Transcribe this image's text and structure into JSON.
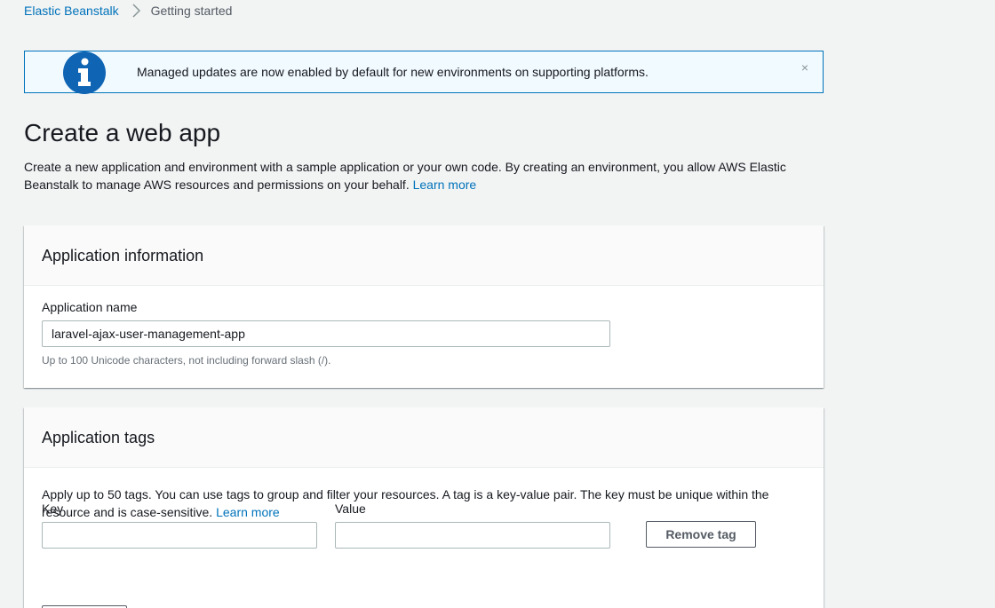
{
  "breadcrumb": {
    "root": "Elastic Beanstalk",
    "current": "Getting started"
  },
  "flash": {
    "message": "Managed updates are now enabled by default for new environments on supporting platforms.",
    "close_glyph": "×",
    "icon": "info-icon"
  },
  "header": {
    "title": "Create a web app",
    "description": "Create a new application and environment with a sample application or your own code. By creating an environment, you allow AWS Elastic Beanstalk to manage AWS resources and permissions on your behalf.",
    "learn_more": "Learn more"
  },
  "app_info": {
    "title": "Application information",
    "name_label": "Application name",
    "name_value": "laravel-ajax-user-management-app",
    "name_hint": "Up to 100 Unicode characters, not including forward slash (/)."
  },
  "app_tags": {
    "title": "Application tags",
    "description": "Apply up to 50 tags. You can use tags to group and filter your resources. A tag is a key-value pair. The key must be unique within the resource and is case-sensitive.",
    "learn_more": "Learn more",
    "key_label": "Key",
    "key_value": "",
    "value_label": "Value",
    "value_value": "",
    "remove_label": "Remove tag"
  },
  "colors": {
    "link": "#0073bb",
    "info_blue": "#0073bb",
    "background": "#f2f3f3"
  }
}
